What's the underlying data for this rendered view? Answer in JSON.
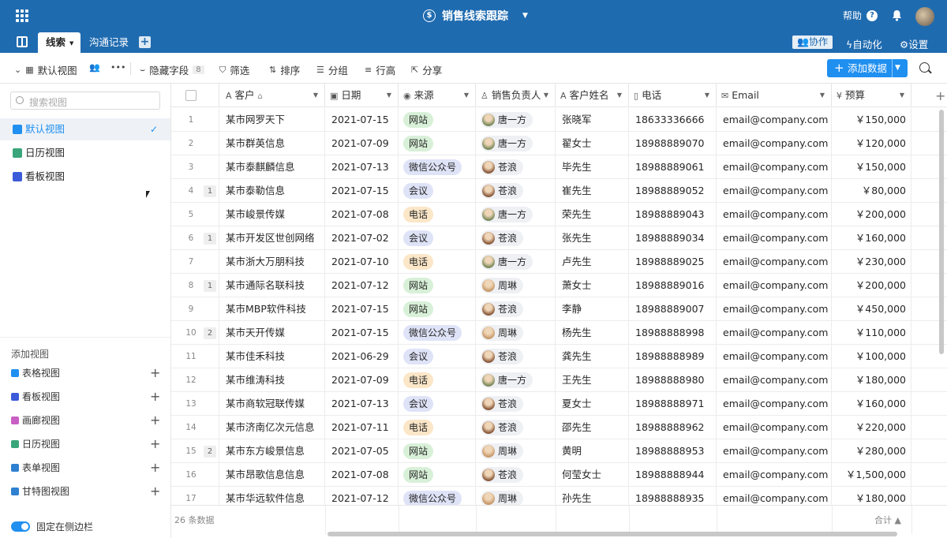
{
  "header": {
    "app_title": "销售线索跟踪",
    "help_label": "帮助",
    "help_glyph": "?",
    "dollar_glyph": "$"
  },
  "tabs": [
    {
      "label": "线索",
      "active": true
    },
    {
      "label": "沟通记录",
      "active": false
    }
  ],
  "tab_add_glyph": "+",
  "right_actions": {
    "collab": "协作",
    "automation": "自动化",
    "settings": "设置"
  },
  "toolbar": {
    "view_name": "默认视图",
    "hide_fields": "隐藏字段",
    "hidden_count": "8",
    "filter": "筛选",
    "sort": "排序",
    "group": "分组",
    "row_height": "行高",
    "share": "分享",
    "add_data": "添加数据"
  },
  "sidebar": {
    "search_placeholder": "搜索视图",
    "views": [
      {
        "label": "默认视图",
        "icon": "grid-view-icon",
        "color": "#1f8ff0",
        "active": true
      },
      {
        "label": "日历视图",
        "icon": "calendar-view-icon",
        "color": "#3aa57a",
        "active": false
      },
      {
        "label": "看板视图",
        "icon": "kanban-view-icon",
        "color": "#3b5bd9",
        "active": false
      }
    ],
    "add_view_title": "添加视图",
    "add_views": [
      {
        "label": "表格视图",
        "color": "#1f8ff0"
      },
      {
        "label": "看板视图",
        "color": "#3b5bd9"
      },
      {
        "label": "画廊视图",
        "color": "#c85fc4"
      },
      {
        "label": "日历视图",
        "color": "#3aa57a"
      },
      {
        "label": "表单视图",
        "color": "#2f80d0"
      },
      {
        "label": "甘特图视图",
        "color": "#2f80d0"
      }
    ],
    "pin_label": "固定在侧边栏"
  },
  "columns": {
    "customer": "客户",
    "date": "日期",
    "source": "来源",
    "owner": "销售负责人",
    "name": "客户姓名",
    "phone": "电话",
    "email": "Email",
    "budget": "预算"
  },
  "source_colors": {
    "网站": "#d8f0d8",
    "微信公众号": "#dfe3f7",
    "会议": "#dfe3f7",
    "电话": "#fbe6c8"
  },
  "owner_avatars": {
    "唐一方": "#7a8a5a",
    "苍浪": "#8a5a3a",
    "周琳": "#c89a6a"
  },
  "rows": [
    {
      "n": "1",
      "c": "",
      "customer": "某市网罗天下",
      "date": "2021-07-15",
      "source": "网站",
      "owner": "唐一方",
      "name": "张晓军",
      "phone": "18633336666",
      "email": "email@company.com",
      "budget": "￥150,000"
    },
    {
      "n": "2",
      "c": "",
      "customer": "某市群英信息",
      "date": "2021-07-09",
      "source": "网站",
      "owner": "唐一方",
      "name": "翟女士",
      "phone": "18988889070",
      "email": "email@company.com",
      "budget": "￥120,000"
    },
    {
      "n": "3",
      "c": "",
      "customer": "某市泰麒麟信息",
      "date": "2021-07-13",
      "source": "微信公众号",
      "owner": "苍浪",
      "name": "毕先生",
      "phone": "18988889061",
      "email": "email@company.com",
      "budget": "￥150,000"
    },
    {
      "n": "4",
      "c": "1",
      "customer": "某市泰勒信息",
      "date": "2021-07-15",
      "source": "会议",
      "owner": "苍浪",
      "name": "崔先生",
      "phone": "18988889052",
      "email": "email@company.com",
      "budget": "￥80,000"
    },
    {
      "n": "5",
      "c": "",
      "customer": "某市峻景传媒",
      "date": "2021-07-08",
      "source": "电话",
      "owner": "唐一方",
      "name": "荣先生",
      "phone": "18988889043",
      "email": "email@company.com",
      "budget": "￥200,000"
    },
    {
      "n": "6",
      "c": "1",
      "customer": "某市开发区世创网络",
      "date": "2021-07-02",
      "source": "会议",
      "owner": "苍浪",
      "name": "张先生",
      "phone": "18988889034",
      "email": "email@company.com",
      "budget": "￥160,000"
    },
    {
      "n": "7",
      "c": "",
      "customer": "某市浙大万朋科技",
      "date": "2021-07-10",
      "source": "电话",
      "owner": "唐一方",
      "name": "卢先生",
      "phone": "18988889025",
      "email": "email@company.com",
      "budget": "￥230,000"
    },
    {
      "n": "8",
      "c": "1",
      "customer": "某市通际名联科技",
      "date": "2021-07-12",
      "source": "网站",
      "owner": "周琳",
      "name": "萧女士",
      "phone": "18988889016",
      "email": "email@company.com",
      "budget": "￥200,000"
    },
    {
      "n": "9",
      "c": "",
      "customer": "某市MBP软件科技",
      "date": "2021-07-15",
      "source": "网站",
      "owner": "苍浪",
      "name": "李静",
      "phone": "18988889007",
      "email": "email@company.com",
      "budget": "￥450,000"
    },
    {
      "n": "10",
      "c": "2",
      "customer": "某市天开传媒",
      "date": "2021-07-15",
      "source": "微信公众号",
      "owner": "周琳",
      "name": "杨先生",
      "phone": "18988888998",
      "email": "email@company.com",
      "budget": "￥110,000"
    },
    {
      "n": "11",
      "c": "",
      "customer": "某市佳禾科技",
      "date": "2021-06-29",
      "source": "会议",
      "owner": "苍浪",
      "name": "龚先生",
      "phone": "18988888989",
      "email": "email@company.com",
      "budget": "￥100,000"
    },
    {
      "n": "12",
      "c": "",
      "customer": "某市维涛科技",
      "date": "2021-07-09",
      "source": "电话",
      "owner": "唐一方",
      "name": "王先生",
      "phone": "18988888980",
      "email": "email@company.com",
      "budget": "￥180,000"
    },
    {
      "n": "13",
      "c": "",
      "customer": "某市商软冠联传媒",
      "date": "2021-07-13",
      "source": "会议",
      "owner": "苍浪",
      "name": "夏女士",
      "phone": "18988888971",
      "email": "email@company.com",
      "budget": "￥160,000"
    },
    {
      "n": "14",
      "c": "",
      "customer": "某市济南亿次元信息",
      "date": "2021-07-11",
      "source": "电话",
      "owner": "苍浪",
      "name": "邵先生",
      "phone": "18988888962",
      "email": "email@company.com",
      "budget": "￥220,000"
    },
    {
      "n": "15",
      "c": "2",
      "customer": "某市东方峻景信息",
      "date": "2021-07-05",
      "source": "网站",
      "owner": "周琳",
      "name": "黄明",
      "phone": "18988888953",
      "email": "email@company.com",
      "budget": "￥280,000"
    },
    {
      "n": "16",
      "c": "",
      "customer": "某市昂歌信息信息",
      "date": "2021-07-08",
      "source": "网站",
      "owner": "苍浪",
      "name": "何莹女士",
      "phone": "18988888944",
      "email": "email@company.com",
      "budget": "￥1,500,000"
    },
    {
      "n": "17",
      "c": "",
      "customer": "某市华远软件信息",
      "date": "2021-07-12",
      "source": "微信公众号",
      "owner": "周琳",
      "name": "孙先生",
      "phone": "18988888935",
      "email": "email@company.com",
      "budget": "￥180,000"
    }
  ],
  "footer": {
    "record_count": "26 条数据",
    "sum_label": "合计"
  }
}
